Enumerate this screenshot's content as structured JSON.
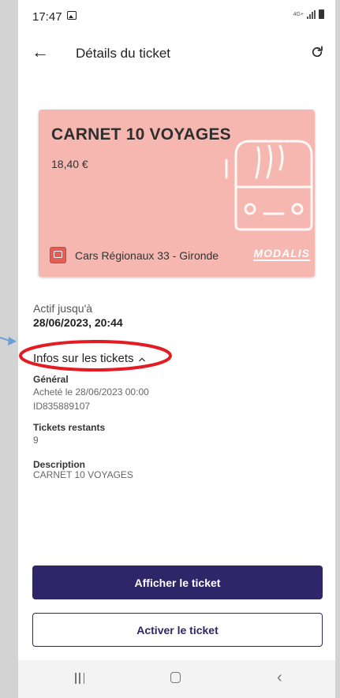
{
  "status_bar": {
    "time": "17:47",
    "network": "4G+"
  },
  "app_bar": {
    "title": "Détails du ticket"
  },
  "ticket": {
    "name": "CARNET 10 VOYAGES",
    "price": "18,40 €",
    "operator": "Cars Régionaux 33 - Gironde",
    "brand": "MODALIS",
    "card_color": "#f5b7b0"
  },
  "validity": {
    "label": "Actif jusqu'à",
    "value": "28/06/2023, 20:44"
  },
  "info_section": {
    "title": "Infos sur les tickets",
    "expanded": true,
    "general": {
      "title": "Général",
      "purchased": "Acheté le 28/06/2023 00:00",
      "id": "ID835889107"
    },
    "remaining": {
      "title": "Tickets restants",
      "value": "9"
    },
    "description": {
      "title": "Description",
      "value": "CARNET 10 VOYAGES"
    }
  },
  "actions": {
    "show_ticket": "Afficher le ticket",
    "activate_ticket": "Activer le ticket"
  },
  "colors": {
    "primary": "#2e2668",
    "annotation_red": "#e31b23",
    "annotation_arrow": "#6a9fd8"
  },
  "icons": [
    "back-arrow-icon",
    "refresh-icon",
    "bus-icon",
    "operator-icon",
    "chevron-up-icon"
  ]
}
